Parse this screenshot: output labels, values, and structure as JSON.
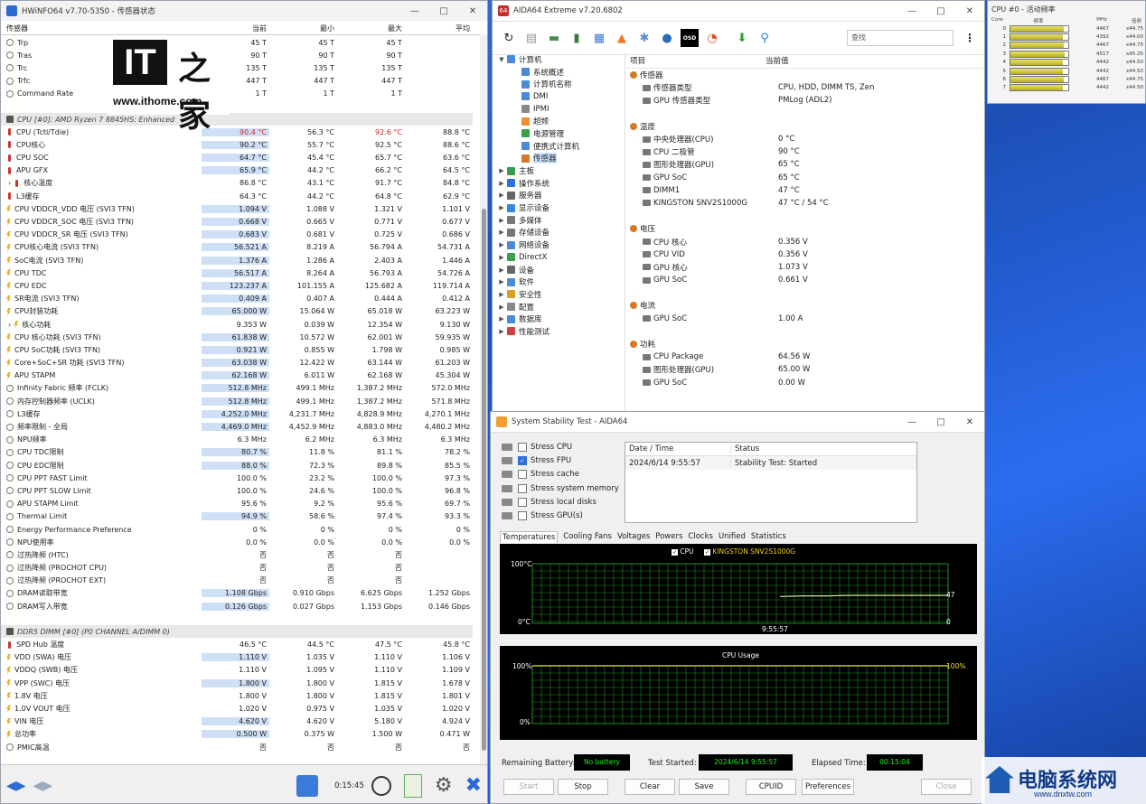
{
  "hwinfo": {
    "title": "HWiNFO64 v7.70-5350 - 传感器状态",
    "columns": [
      "传感器",
      "当前",
      "最小",
      "最大",
      "平均"
    ],
    "rows": [
      {
        "t": "r",
        "ic": "clock",
        "n": "Trp",
        "v": [
          "45 T",
          "45 T",
          "45 T",
          ""
        ]
      },
      {
        "t": "r",
        "ic": "clock",
        "n": "Tras",
        "v": [
          "90 T",
          "90 T",
          "90 T",
          ""
        ]
      },
      {
        "t": "r",
        "ic": "clock",
        "n": "Trc",
        "v": [
          "135 T",
          "135 T",
          "135 T",
          ""
        ]
      },
      {
        "t": "r",
        "ic": "clock",
        "n": "Trfc",
        "v": [
          "447 T",
          "447 T",
          "447 T",
          ""
        ]
      },
      {
        "t": "r",
        "ic": "clock",
        "n": "Command Rate",
        "v": [
          "1 T",
          "1 T",
          "1 T",
          ""
        ]
      },
      {
        "t": "gap"
      },
      {
        "t": "g",
        "n": "CPU [#0]: AMD Ryzen 7 8845HS: Enhanced"
      },
      {
        "t": "r",
        "ic": "therm",
        "n": "CPU (Tctl/Tdie)",
        "v": [
          "90.4 °C",
          "56.3 °C",
          "92.6 °C",
          "88.8 °C"
        ],
        "red": [
          0,
          2
        ],
        "hl": 1
      },
      {
        "t": "r",
        "ic": "therm",
        "n": "CPU核心",
        "v": [
          "90.2 °C",
          "55.7 °C",
          "92.5 °C",
          "88.6 °C"
        ],
        "hl": 1
      },
      {
        "t": "r",
        "ic": "therm",
        "n": "CPU SOC",
        "v": [
          "64.7 °C",
          "45.4 °C",
          "65.7 °C",
          "63.6 °C"
        ],
        "hl": 1
      },
      {
        "t": "r",
        "ic": "therm",
        "n": "APU GFX",
        "v": [
          "65.9 °C",
          "44.2 °C",
          "66.2 °C",
          "64.5 °C"
        ],
        "hl": 1
      },
      {
        "t": "r",
        "ic": "therm",
        "n": "核心温度",
        "x": 1,
        "v": [
          "86.8 °C",
          "43.1 °C",
          "91.7 °C",
          "84.8 °C"
        ]
      },
      {
        "t": "r",
        "ic": "therm",
        "n": "L3缓存",
        "v": [
          "64.3 °C",
          "44.2 °C",
          "64.8 °C",
          "62.9 °C"
        ]
      },
      {
        "t": "r",
        "ic": "volt",
        "n": "CPU VDDCR_VDD 电压 (SVI3 TFN)",
        "v": [
          "1.094 V",
          "1.088 V",
          "1.321 V",
          "1.101 V"
        ],
        "hl": 1
      },
      {
        "t": "r",
        "ic": "volt",
        "n": "CPU VDDCR_SOC 电压 (SVI3 TFN)",
        "v": [
          "0.668 V",
          "0.665 V",
          "0.771 V",
          "0.677 V"
        ],
        "hl": 1
      },
      {
        "t": "r",
        "ic": "volt",
        "n": "CPU VDDCR_SR 电压 (SVI3 TFN)",
        "v": [
          "0.683 V",
          "0.681 V",
          "0.725 V",
          "0.686 V"
        ],
        "hl": 1
      },
      {
        "t": "r",
        "ic": "volt",
        "n": "CPU核心电流 (SVI3 TFN)",
        "v": [
          "56.521 A",
          "8.219 A",
          "56.794 A",
          "54.731 A"
        ],
        "hl": 1
      },
      {
        "t": "r",
        "ic": "volt",
        "n": "SoC电流 (SVI3 TFN)",
        "v": [
          "1.376 A",
          "1.286 A",
          "2.403 A",
          "1.446 A"
        ],
        "hl": 1
      },
      {
        "t": "r",
        "ic": "volt",
        "n": "CPU TDC",
        "v": [
          "56.517 A",
          "8.264 A",
          "56.793 A",
          "54.726 A"
        ],
        "hl": 1
      },
      {
        "t": "r",
        "ic": "volt",
        "n": "CPU EDC",
        "v": [
          "123.237 A",
          "101.155 A",
          "125.682 A",
          "119.714 A"
        ],
        "hl": 1
      },
      {
        "t": "r",
        "ic": "volt",
        "n": "SR电流 (SVI3 TFN)",
        "v": [
          "0.409 A",
          "0.407 A",
          "0.444 A",
          "0.412 A"
        ],
        "hl": 1
      },
      {
        "t": "r",
        "ic": "volt",
        "n": "CPU封装功耗",
        "v": [
          "65.000 W",
          "15.064 W",
          "65.018 W",
          "63.223 W"
        ],
        "hl": 1
      },
      {
        "t": "r",
        "ic": "volt",
        "n": "核心功耗",
        "x": 1,
        "v": [
          "9.353 W",
          "0.039 W",
          "12.354 W",
          "9.130 W"
        ]
      },
      {
        "t": "r",
        "ic": "volt",
        "n": "CPU 核心功耗 (SVI3 TFN)",
        "v": [
          "61.838 W",
          "10.572 W",
          "62.001 W",
          "59.935 W"
        ],
        "hl": 1
      },
      {
        "t": "r",
        "ic": "volt",
        "n": "CPU SoC功耗 (SVI3 TFN)",
        "v": [
          "0.921 W",
          "0.855 W",
          "1.798 W",
          "0.985 W"
        ],
        "hl": 1
      },
      {
        "t": "r",
        "ic": "volt",
        "n": "Core+SoC+SR 功耗 (SVI3 TFN)",
        "v": [
          "63.038 W",
          "12.422 W",
          "63.144 W",
          "61.203 W"
        ],
        "hl": 1
      },
      {
        "t": "r",
        "ic": "volt",
        "n": "APU STAPM",
        "v": [
          "62.168 W",
          "6.011 W",
          "62.168 W",
          "45.304 W"
        ],
        "hl": 1
      },
      {
        "t": "r",
        "ic": "clock",
        "n": "Infinity Fabric 频率 (FCLK)",
        "v": [
          "512.8 MHz",
          "499.1 MHz",
          "1,387.2 MHz",
          "572.0 MHz"
        ],
        "hl": 1
      },
      {
        "t": "r",
        "ic": "clock",
        "n": "内存控制器频率 (UCLK)",
        "v": [
          "512.8 MHz",
          "499.1 MHz",
          "1,387.2 MHz",
          "571.8 MHz"
        ],
        "hl": 1
      },
      {
        "t": "r",
        "ic": "clock",
        "n": "L3缓存",
        "v": [
          "4,252.0 MHz",
          "4,231.7 MHz",
          "4,828.9 MHz",
          "4,270.1 MHz"
        ],
        "hl": 1
      },
      {
        "t": "r",
        "ic": "clock",
        "n": "频率限制 - 全局",
        "v": [
          "4,469.0 MHz",
          "4,452.9 MHz",
          "4,883.0 MHz",
          "4,480.2 MHz"
        ],
        "hl": 1
      },
      {
        "t": "r",
        "ic": "clock",
        "n": "NPU频率",
        "v": [
          "6.3 MHz",
          "6.2 MHz",
          "6.3 MHz",
          "6.3 MHz"
        ]
      },
      {
        "t": "r",
        "ic": "clock",
        "n": "CPU TDC限制",
        "v": [
          "80.7 %",
          "11.8 %",
          "81.1 %",
          "78.2 %"
        ],
        "hl": 1
      },
      {
        "t": "r",
        "ic": "clock",
        "n": "CPU EDC限制",
        "v": [
          "88.0 %",
          "72.3 %",
          "89.8 %",
          "85.5 %"
        ],
        "hl": 1
      },
      {
        "t": "r",
        "ic": "clock",
        "n": "CPU PPT FAST Limit",
        "v": [
          "100.0 %",
          "23.2 %",
          "100.0 %",
          "97.3 %"
        ]
      },
      {
        "t": "r",
        "ic": "clock",
        "n": "CPU PPT SLOW Limit",
        "v": [
          "100.0 %",
          "24.6 %",
          "100.0 %",
          "96.8 %"
        ]
      },
      {
        "t": "r",
        "ic": "clock",
        "n": "APU STAPM Limit",
        "v": [
          "95.6 %",
          "9.2 %",
          "95.6 %",
          "69.7 %"
        ]
      },
      {
        "t": "r",
        "ic": "clock",
        "n": "Thermal Limit",
        "v": [
          "94.9 %",
          "58.6 %",
          "97.4 %",
          "93.3 %"
        ],
        "hl": 1
      },
      {
        "t": "r",
        "ic": "clock",
        "n": "Energy Performance Preference",
        "v": [
          "0 %",
          "0 %",
          "0 %",
          "0 %"
        ]
      },
      {
        "t": "r",
        "ic": "clock",
        "n": "NPU使用率",
        "v": [
          "0.0 %",
          "0.0 %",
          "0.0 %",
          "0.0 %"
        ]
      },
      {
        "t": "r",
        "ic": "clock",
        "n": "过热降频 (HTC)",
        "v": [
          "否",
          "否",
          "否",
          ""
        ]
      },
      {
        "t": "r",
        "ic": "clock",
        "n": "过热降频 (PROCHOT CPU)",
        "v": [
          "否",
          "否",
          "否",
          ""
        ]
      },
      {
        "t": "r",
        "ic": "clock",
        "n": "过热降频 (PROCHOT EXT)",
        "v": [
          "否",
          "否",
          "否",
          ""
        ]
      },
      {
        "t": "r",
        "ic": "clock",
        "n": "DRAM读取带宽",
        "v": [
          "1.108 Gbps",
          "0.910 Gbps",
          "6.625 Gbps",
          "1.252 Gbps"
        ],
        "hl": 1
      },
      {
        "t": "r",
        "ic": "clock",
        "n": "DRAM写入带宽",
        "v": [
          "0.126 Gbps",
          "0.027 Gbps",
          "1.153 Gbps",
          "0.146 Gbps"
        ],
        "hl": 1
      },
      {
        "t": "gap"
      },
      {
        "t": "g",
        "n": "DDR5 DIMM [#0] (P0 CHANNEL A/DIMM 0)"
      },
      {
        "t": "r",
        "ic": "therm",
        "n": "SPD Hub 温度",
        "v": [
          "46.5 °C",
          "44.5 °C",
          "47.5 °C",
          "45.8 °C"
        ]
      },
      {
        "t": "r",
        "ic": "volt",
        "n": "VDD (SWA) 电压",
        "v": [
          "1.110 V",
          "1.035 V",
          "1.110 V",
          "1.106 V"
        ],
        "hl": 1
      },
      {
        "t": "r",
        "ic": "volt",
        "n": "VDDQ (SWB) 电压",
        "v": [
          "1.110 V",
          "1.095 V",
          "1.110 V",
          "1.109 V"
        ]
      },
      {
        "t": "r",
        "ic": "volt",
        "n": "VPP (SWC) 电压",
        "v": [
          "1.800 V",
          "1.800 V",
          "1.815 V",
          "1.678 V"
        ],
        "hl": 1
      },
      {
        "t": "r",
        "ic": "volt",
        "n": "1.8V 电压",
        "v": [
          "1.800 V",
          "1.800 V",
          "1.815 V",
          "1.801 V"
        ]
      },
      {
        "t": "r",
        "ic": "volt",
        "n": "1.0V VOUT 电压",
        "v": [
          "1.020 V",
          "0.975 V",
          "1.035 V",
          "1.020 V"
        ]
      },
      {
        "t": "r",
        "ic": "volt",
        "n": "VIN 电压",
        "v": [
          "4.620 V",
          "4.620 V",
          "5.180 V",
          "4.924 V"
        ],
        "hl": 1
      },
      {
        "t": "r",
        "ic": "volt",
        "n": "总功率",
        "v": [
          "0.500 W",
          "0.375 W",
          "1.500 W",
          "0.471 W"
        ],
        "hl": 1
      },
      {
        "t": "r",
        "ic": "clock",
        "n": "PMIC高温",
        "v": [
          "否",
          "否",
          "否",
          "否"
        ]
      }
    ],
    "footer": {
      "time": "0:15:45"
    },
    "watermark": {
      "url": "www.ithome.com",
      "logo_latin": "IT",
      "logo_cn": "之家"
    }
  },
  "aida": {
    "title": "AIDA64 Extreme v7.20.6802",
    "search": "查找",
    "tree": [
      {
        "n": "计算机",
        "lvl": 0,
        "open": 1,
        "c": "#4a8ad8"
      },
      {
        "n": "系统概述",
        "lvl": 1,
        "c": "#4a8ad8"
      },
      {
        "n": "计算机名称",
        "lvl": 1,
        "c": "#4a8ad8"
      },
      {
        "n": "DMI",
        "lvl": 1,
        "c": "#4a8ad8"
      },
      {
        "n": "IPMI",
        "lvl": 1,
        "c": "#888"
      },
      {
        "n": "超频",
        "lvl": 1,
        "c": "#f0902a"
      },
      {
        "n": "电源管理",
        "lvl": 1,
        "c": "#3aa04a"
      },
      {
        "n": "便携式计算机",
        "lvl": 1,
        "c": "#4a8ad8"
      },
      {
        "n": "传感器",
        "lvl": 1,
        "c": "#d47a2a",
        "sel": 1
      },
      {
        "n": "主板",
        "lvl": 0,
        "c": "#3a9a4a"
      },
      {
        "n": "操作系统",
        "lvl": 0,
        "c": "#2f6fd8"
      },
      {
        "n": "服务器",
        "lvl": 0,
        "c": "#666"
      },
      {
        "n": "显示设备",
        "lvl": 0,
        "c": "#2f8ad8"
      },
      {
        "n": "多媒体",
        "lvl": 0,
        "c": "#777"
      },
      {
        "n": "存储设备",
        "lvl": 0,
        "c": "#777"
      },
      {
        "n": "网络设备",
        "lvl": 0,
        "c": "#4a8ad8"
      },
      {
        "n": "DirectX",
        "lvl": 0,
        "c": "#3aa04a"
      },
      {
        "n": "设备",
        "lvl": 0,
        "c": "#666"
      },
      {
        "n": "软件",
        "lvl": 0,
        "c": "#4a8ad8"
      },
      {
        "n": "安全性",
        "lvl": 0,
        "c": "#d8a020"
      },
      {
        "n": "配置",
        "lvl": 0,
        "c": "#888"
      },
      {
        "n": "数据库",
        "lvl": 0,
        "c": "#4a8ad8"
      },
      {
        "n": "性能测试",
        "lvl": 0,
        "c": "#d04040"
      }
    ],
    "detail_header": [
      "项目",
      "当前值"
    ],
    "detail": [
      {
        "t": "sec",
        "k": "传感器"
      },
      {
        "t": "item",
        "k": "传感器类型",
        "v": "CPU, HDD, DIMM TS, Zen"
      },
      {
        "t": "item",
        "k": "GPU 传感器类型",
        "v": "PMLog  (ADL2)"
      },
      {
        "t": "gap"
      },
      {
        "t": "sec",
        "k": "温度"
      },
      {
        "t": "item",
        "k": "中央处理器(CPU)",
        "v": "0 °C"
      },
      {
        "t": "item",
        "k": "CPU 二极管",
        "v": "90 °C"
      },
      {
        "t": "item",
        "k": "图形处理器(GPU)",
        "v": "65 °C"
      },
      {
        "t": "item",
        "k": "GPU SoC",
        "v": "65 °C"
      },
      {
        "t": "item",
        "k": "DIMM1",
        "v": "47 °C"
      },
      {
        "t": "item",
        "k": "KINGSTON SNV2S1000G",
        "v": "47 °C / 54 °C"
      },
      {
        "t": "gap"
      },
      {
        "t": "sec",
        "k": "电压"
      },
      {
        "t": "item",
        "k": "CPU 核心",
        "v": "0.356 V"
      },
      {
        "t": "item",
        "k": "CPU VID",
        "v": "0.356 V"
      },
      {
        "t": "item",
        "k": "GPU 核心",
        "v": "1.073 V"
      },
      {
        "t": "item",
        "k": "GPU SoC",
        "v": "0.661 V"
      },
      {
        "t": "gap"
      },
      {
        "t": "sec",
        "k": "电流"
      },
      {
        "t": "item",
        "k": "GPU SoC",
        "v": "1.00 A"
      },
      {
        "t": "gap"
      },
      {
        "t": "sec",
        "k": "功耗"
      },
      {
        "t": "item",
        "k": "CPU Package",
        "v": "64.56 W"
      },
      {
        "t": "item",
        "k": "图形处理器(GPU)",
        "v": "65.00 W"
      },
      {
        "t": "item",
        "k": "GPU SoC",
        "v": "0.00 W"
      }
    ]
  },
  "freq": {
    "title": "CPU #0 - 活动频率",
    "header": [
      "Core",
      "频率",
      "MHz",
      "倍频"
    ],
    "cores": [
      {
        "n": "0",
        "mhz": "4467",
        "mult": "x44.75",
        "fill": 0.92
      },
      {
        "n": "1",
        "mhz": "4392",
        "mult": "x44.00",
        "fill": 0.9
      },
      {
        "n": "2",
        "mhz": "4467",
        "mult": "x44.75",
        "fill": 0.92
      },
      {
        "n": "3",
        "mhz": "4517",
        "mult": "x45.25",
        "fill": 0.94
      },
      {
        "n": "4",
        "mhz": "4442",
        "mult": "x44.50",
        "fill": 0.91
      },
      {
        "n": "5",
        "mhz": "4442",
        "mult": "x44.50",
        "fill": 0.91
      },
      {
        "n": "6",
        "mhz": "4467",
        "mult": "x44.75",
        "fill": 0.92
      },
      {
        "n": "7",
        "mhz": "4442",
        "mult": "x44.50",
        "fill": 0.91
      }
    ]
  },
  "sst": {
    "title": "System Stability Test - AIDA64",
    "checks": [
      {
        "n": "Stress CPU",
        "on": false
      },
      {
        "n": "Stress FPU",
        "on": true
      },
      {
        "n": "Stress cache",
        "on": false
      },
      {
        "n": "Stress system memory",
        "on": false
      },
      {
        "n": "Stress local disks",
        "on": false
      },
      {
        "n": "Stress GPU(s)",
        "on": false
      }
    ],
    "log_header": [
      "Date / Time",
      "Status"
    ],
    "log_row": [
      "2024/6/14 9:55:57",
      "Stability Test: Started"
    ],
    "tabs": [
      "Temperatures",
      "Cooling Fans",
      "Voltages",
      "Powers",
      "Clocks",
      "Unified",
      "Statistics"
    ],
    "temp_graph": {
      "legend": [
        "CPU",
        "KINGSTON SNV2S1000G"
      ],
      "ymax": "100°C",
      "ymin": "0°C",
      "time": "9:55:57",
      "right_top": "47",
      "right_bottom": "0"
    },
    "cpu_graph": {
      "title": "CPU Usage",
      "ymax": "100%",
      "ymin": "0%",
      "right": "100%"
    },
    "battery_label": "Remaining Battery:",
    "battery": "No battery",
    "started_label": "Test Started:",
    "started": "2024/6/14 9:55:57",
    "elapsed_label": "Elapsed Time:",
    "elapsed": "00:15:04",
    "buttons": [
      "Start",
      "Stop",
      "Clear",
      "Save",
      "CPUID",
      "Preferences",
      "Close"
    ]
  },
  "site_watermark": {
    "name": "电脑系统网",
    "url": "www.dnxtw.com"
  },
  "chart_data": [
    {
      "type": "line",
      "title": "",
      "legend": [
        "CPU",
        "KINGSTON SNV2S1000G"
      ],
      "ylim": [
        0,
        100
      ],
      "series": [
        {
          "name": "KINGSTON SNV2S1000G",
          "values": [
            45,
            46,
            46,
            47,
            47,
            47,
            47,
            47
          ]
        }
      ],
      "x": [
        "9:55:57"
      ]
    },
    {
      "type": "line",
      "title": "CPU Usage",
      "ylim": [
        0,
        100
      ],
      "series": [
        {
          "name": "CPU Usage",
          "values": [
            100,
            100,
            100,
            100,
            100
          ]
        }
      ]
    }
  ]
}
